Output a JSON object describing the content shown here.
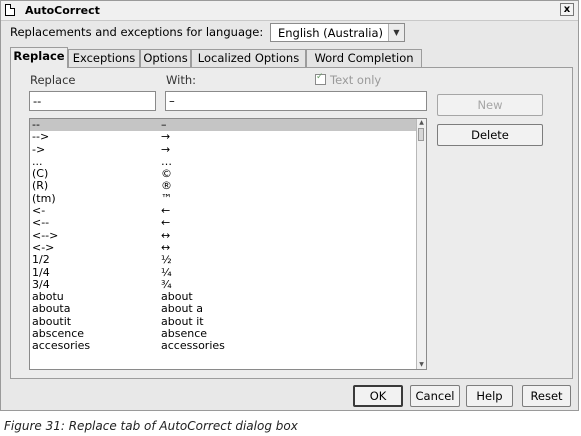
{
  "window": {
    "title": "AutoCorrect",
    "close_glyph": "x"
  },
  "language": {
    "label": "Replacements and exceptions for language:",
    "selected": "English (Australia)"
  },
  "tabs": [
    {
      "label": "Replace",
      "active": true
    },
    {
      "label": "Exceptions",
      "active": false
    },
    {
      "label": "Options",
      "active": false
    },
    {
      "label": "Localized Options",
      "active": false
    },
    {
      "label": "Word Completion",
      "active": false
    }
  ],
  "replace_tab": {
    "replace_label": "Replace",
    "with_label": "With:",
    "text_only_label": "Text only",
    "text_only_checked": true,
    "replace_value": "--",
    "with_value": "–",
    "new_label": "New",
    "delete_label": "Delete",
    "entries": [
      {
        "replace": "--",
        "with": "–"
      },
      {
        "replace": "-->",
        "with": "→"
      },
      {
        "replace": "->",
        "with": "→"
      },
      {
        "replace": "...",
        "with": "…"
      },
      {
        "replace": "(C)",
        "with": "©"
      },
      {
        "replace": "(R)",
        "with": "®"
      },
      {
        "replace": "(tm)",
        "with": "™"
      },
      {
        "replace": "<-",
        "with": "←"
      },
      {
        "replace": "<--",
        "with": "←"
      },
      {
        "replace": "<-->",
        "with": "↔"
      },
      {
        "replace": "<->",
        "with": "↔"
      },
      {
        "replace": "1/2",
        "with": "½"
      },
      {
        "replace": "1/4",
        "with": "¼"
      },
      {
        "replace": "3/4",
        "with": "¾"
      },
      {
        "replace": "abotu",
        "with": "about"
      },
      {
        "replace": "abouta",
        "with": "about a"
      },
      {
        "replace": "aboutit",
        "with": "about it"
      },
      {
        "replace": "abscence",
        "with": "absence"
      },
      {
        "replace": "accesories",
        "with": "accessories"
      }
    ]
  },
  "footer": {
    "ok_label": "OK",
    "cancel_label": "Cancel",
    "help_label": "Help",
    "reset_label": "Reset"
  },
  "caption": "Figure 31: Replace tab of AutoCorrect dialog box"
}
